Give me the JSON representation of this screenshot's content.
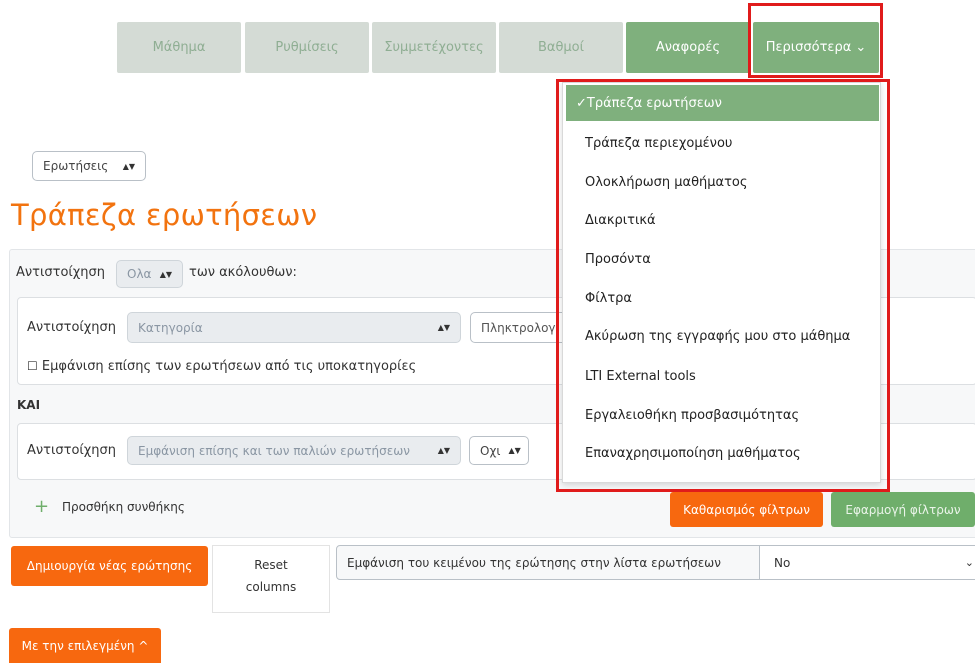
{
  "tabs": [
    {
      "label": "Μάθημα",
      "active": false
    },
    {
      "label": "Ρυθμίσεις",
      "active": false
    },
    {
      "label": "Συμμετέχοντες",
      "active": false
    },
    {
      "label": "Βαθμοί",
      "active": false
    },
    {
      "label": "Αναφορές",
      "active": true
    },
    {
      "label": "Περισσότερα ⌄",
      "active": true
    }
  ],
  "questions_select": "Ερωτήσεις",
  "page_title": "Τράπεζα ερωτήσεων",
  "filter": {
    "match_label": "Αντιστοίχηση",
    "match_all_value": "Ολα",
    "match_suffix": "των ακόλουθων:",
    "cond1_label": "Αντιστοίχηση",
    "category_placeholder": "Κατηγορία",
    "keyword_placeholder": "Πληκτρολογ",
    "subcategories_label": "Εμφάνιση επίσης των ερωτήσεων από τις υποκατηγορίες",
    "and_label": "ΚΑΙ",
    "cond2_label": "Αντιστοίχηση",
    "old_questions_value": "Εμφάνιση επίσης και των παλιών ερωτήσεων",
    "no_value": "Οχι",
    "add_condition_label": "Προσθήκη συνθήκης",
    "clear_button": "Καθαρισμός φίλτρων",
    "apply_button": "Εφαρμογή φίλτρων"
  },
  "actions": {
    "create_question": "Δημιουργία νέας ερώτησης",
    "reset_columns_line1": "Reset",
    "reset_columns_line2": "columns",
    "show_text_label": "Εμφάνιση του κειμένου της ερώτησης στην λίστα ερωτήσεων",
    "show_text_value": "No",
    "with_selected": "Με την επιλεγμένη ^"
  },
  "dropdown": {
    "items": [
      {
        "label": "✓Τράπεζα ερωτήσεων",
        "active": true
      },
      {
        "label": "Τράπεζα περιεχομένου"
      },
      {
        "label": "Ολοκλήρωση μαθήματος"
      },
      {
        "label": "Διακριτικά"
      },
      {
        "label": "Προσόντα"
      },
      {
        "label": "Φίλτρα"
      },
      {
        "label": "Ακύρωση της εγγραφής μου στο μάθημα"
      },
      {
        "label": "LTI External tools"
      },
      {
        "label": "Εργαλειοθήκη προσβασιμότητας"
      },
      {
        "label": "Επαναχρησιμοποίηση μαθήματος"
      }
    ]
  },
  "colors": {
    "accent_orange": "#f7680f",
    "active_green": "#7fb07d",
    "highlight_red": "#e01b1b"
  }
}
